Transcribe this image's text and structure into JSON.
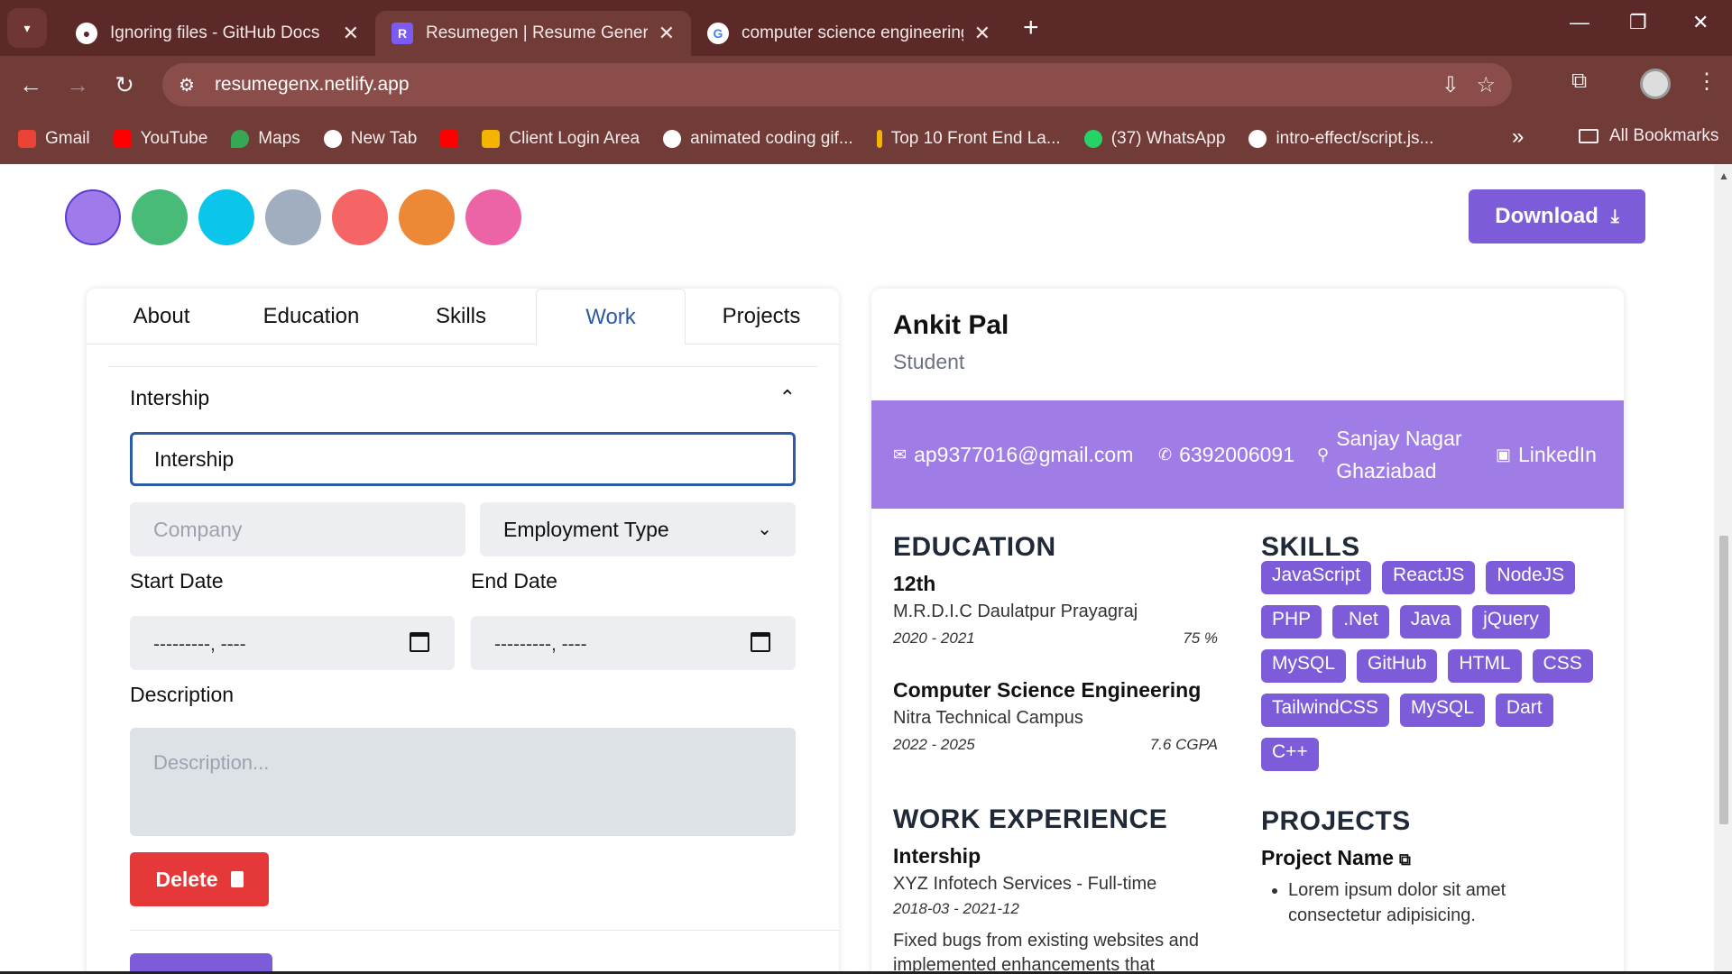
{
  "browser": {
    "tabs": [
      {
        "title": "Ignoring files - GitHub Docs",
        "icon": "github-icon"
      },
      {
        "title": "Resumegen | Resume Generator",
        "icon": "resumegen-icon",
        "active": true
      },
      {
        "title": "computer science engineering -",
        "icon": "google-icon"
      }
    ],
    "url": "resumegenx.netlify.app",
    "bookmarks": [
      {
        "label": "Gmail",
        "color": "#ea4335"
      },
      {
        "label": "YouTube",
        "color": "#ff0000"
      },
      {
        "label": "Maps",
        "color": "#34a853"
      },
      {
        "label": "New Tab",
        "color": "#ffffff"
      },
      {
        "label": "",
        "color": "#ff0000"
      },
      {
        "label": "Client Login Area",
        "color": "#f4b400"
      },
      {
        "label": "animated coding gif...",
        "color": "#ffffff"
      },
      {
        "label": "Top 10 Front End La...",
        "color": "#f4b400"
      },
      {
        "label": "(37) WhatsApp",
        "color": "#25d366"
      },
      {
        "label": "intro-effect/script.js...",
        "color": "#ffffff"
      }
    ],
    "all_bookmarks": "All Bookmarks"
  },
  "theme_swatches": [
    "#9f7aea",
    "#48bb78",
    "#0bc5ea",
    "#a0aec0",
    "#f56565",
    "#ed8936",
    "#ed64a6"
  ],
  "download_label": "Download",
  "editor": {
    "tabs": [
      "About",
      "Education",
      "Skills",
      "Work",
      "Projects"
    ],
    "active_tab": "Work",
    "section_title": "Intership",
    "title_value": "Intership",
    "company_placeholder": "Company",
    "employment_type": "Employment Type",
    "start_date_label": "Start Date",
    "end_date_label": "End Date",
    "start_date_value": "---------, ----",
    "end_date_value": "---------, ----",
    "description_label": "Description",
    "description_placeholder": "Description...",
    "delete_label": "Delete"
  },
  "resume": {
    "name": "Ankit Pal",
    "role": "Student",
    "email": "ap9377016@gmail.com",
    "phone": "6392006091",
    "address_line1": "Sanjay Nagar",
    "address_line2": "Ghaziabad",
    "linkedin": "LinkedIn",
    "education_heading": "EDUCATION",
    "education": [
      {
        "degree": "12th",
        "school": "M.R.D.I.C Daulatpur Prayagraj",
        "years": "2020 - 2021",
        "grade": "75 %"
      },
      {
        "degree": "Computer Science Engineering",
        "school": "Nitra Technical Campus",
        "years": "2022 - 2025",
        "grade": "7.6 CGPA"
      }
    ],
    "skills_heading": "SKILLS",
    "skills": [
      "JavaScript",
      "ReactJS",
      "NodeJS",
      "PHP",
      ".Net",
      "Java",
      "jQuery",
      "MySQL",
      "GitHub",
      "HTML",
      "CSS",
      "TailwindCSS",
      "MySQL",
      "Dart",
      "C++"
    ],
    "work_heading": "WORK EXPERIENCE",
    "work": {
      "title": "Intership",
      "company": "XYZ Infotech Services - Full-time",
      "dates": "2018-03 - 2021-12",
      "description": "Fixed bugs from existing websites and implemented enhancements that"
    },
    "projects_heading": "PROJECTS",
    "project": {
      "name": "Project Name",
      "bullet": "Lorem ipsum dolor sit amet consectetur adipisicing."
    }
  }
}
